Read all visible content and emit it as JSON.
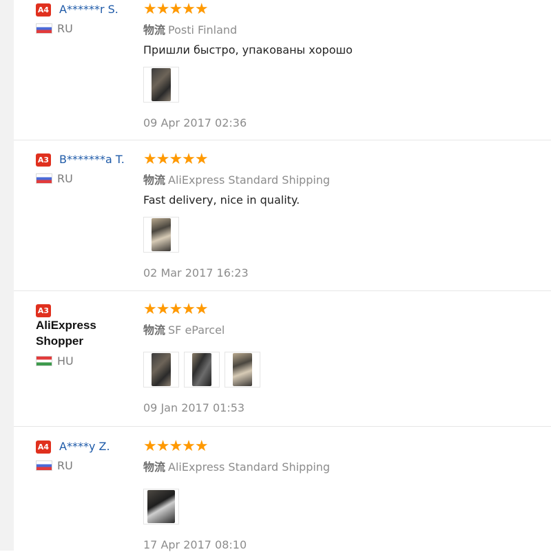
{
  "reviews": [
    {
      "badge": "A4",
      "name": "A******r S.",
      "country": "RU",
      "flag": "ru",
      "rating": 5,
      "stars": "★★★★★",
      "logistics_label": "物流",
      "logistics_value": "Posti Finland",
      "comment": "Пришли быстро, упакованы хорошо",
      "photos": 1,
      "date": "09 Apr 2017 02:36"
    },
    {
      "badge": "A3",
      "name": "B*******a T.",
      "country": "RU",
      "flag": "ru",
      "rating": 5,
      "stars": "★★★★★",
      "logistics_label": "物流",
      "logistics_value": "AliExpress Standard Shipping",
      "comment": "Fast delivery, nice in quality.",
      "photos": 1,
      "date": "02 Mar 2017 16:23"
    },
    {
      "badge": "A3",
      "name": "AliExpress Shopper",
      "country": "HU",
      "flag": "hu",
      "rating": 5,
      "stars": "★★★★★",
      "logistics_label": "物流",
      "logistics_value": "SF eParcel",
      "comment": "",
      "photos": 3,
      "date": "09 Jan 2017 01:53"
    },
    {
      "badge": "A4",
      "name": "A****y Z.",
      "country": "RU",
      "flag": "ru",
      "rating": 5,
      "stars": "★★★★★",
      "logistics_label": "物流",
      "logistics_value": "AliExpress Standard Shipping",
      "comment": "",
      "photos": 1,
      "date": "17 Apr 2017 08:10"
    }
  ]
}
